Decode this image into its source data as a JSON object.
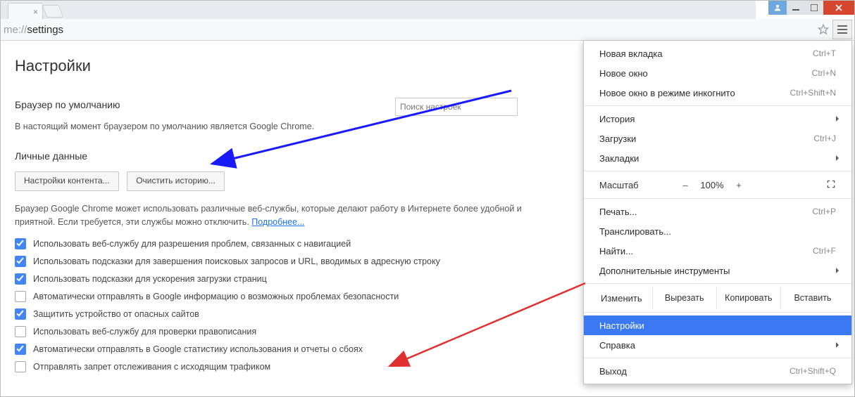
{
  "addr": {
    "prefix": "me://",
    "path": "settings"
  },
  "page": {
    "title": "Настройки",
    "search_placeholder": "Поиск настроек",
    "sections": {
      "default_browser": {
        "heading": "Браузер по умолчанию",
        "text": "В настоящий момент браузером по умолчанию является Google Chrome."
      },
      "privacy": {
        "heading": "Личные данные",
        "btn_content": "Настройки контента...",
        "btn_clear": "Очистить историю...",
        "desc": "Браузер Google Chrome может использовать различные веб-службы, которые делают работу в Интернете более удобной и приятной. Если требуется, эти службы можно отключить. ",
        "more": "Подробнее...",
        "checks": [
          {
            "on": true,
            "label": "Использовать веб-службу для разрешения проблем, связанных с навигацией"
          },
          {
            "on": true,
            "label": "Использовать подсказки для завершения поисковых запросов и URL, вводимых в адресную строку"
          },
          {
            "on": true,
            "label": "Использовать подсказки для ускорения загрузки страниц"
          },
          {
            "on": false,
            "label": "Автоматически отправлять в Google информацию о возможных проблемах безопасности"
          },
          {
            "on": true,
            "label": "Защитить устройство от опасных сайтов"
          },
          {
            "on": false,
            "label": "Использовать веб-службу для проверки правописания"
          },
          {
            "on": true,
            "label": "Автоматически отправлять в Google статистику использования и отчеты о сбоях"
          },
          {
            "on": false,
            "label": "Отправлять запрет отслеживания с исходящим трафиком"
          }
        ]
      }
    }
  },
  "menu": {
    "new_tab": {
      "label": "Новая вкладка",
      "short": "Ctrl+T"
    },
    "new_window": {
      "label": "Новое окно",
      "short": "Ctrl+N"
    },
    "incognito": {
      "label": "Новое окно в режиме инкогнито",
      "short": "Ctrl+Shift+N"
    },
    "history": {
      "label": "История"
    },
    "downloads": {
      "label": "Загрузки",
      "short": "Ctrl+J"
    },
    "bookmarks": {
      "label": "Закладки"
    },
    "zoom": {
      "label": "Масштаб",
      "minus": "–",
      "value": "100%",
      "plus": "+"
    },
    "print": {
      "label": "Печать...",
      "short": "Ctrl+P"
    },
    "cast": {
      "label": "Транслировать..."
    },
    "find": {
      "label": "Найти...",
      "short": "Ctrl+F"
    },
    "more_tools": {
      "label": "Дополнительные инструменты"
    },
    "edit": {
      "label": "Изменить",
      "cut": "Вырезать",
      "copy": "Копировать",
      "paste": "Вставить"
    },
    "settings": {
      "label": "Настройки"
    },
    "help": {
      "label": "Справка"
    },
    "exit": {
      "label": "Выход",
      "short": "Ctrl+Shift+Q"
    }
  }
}
